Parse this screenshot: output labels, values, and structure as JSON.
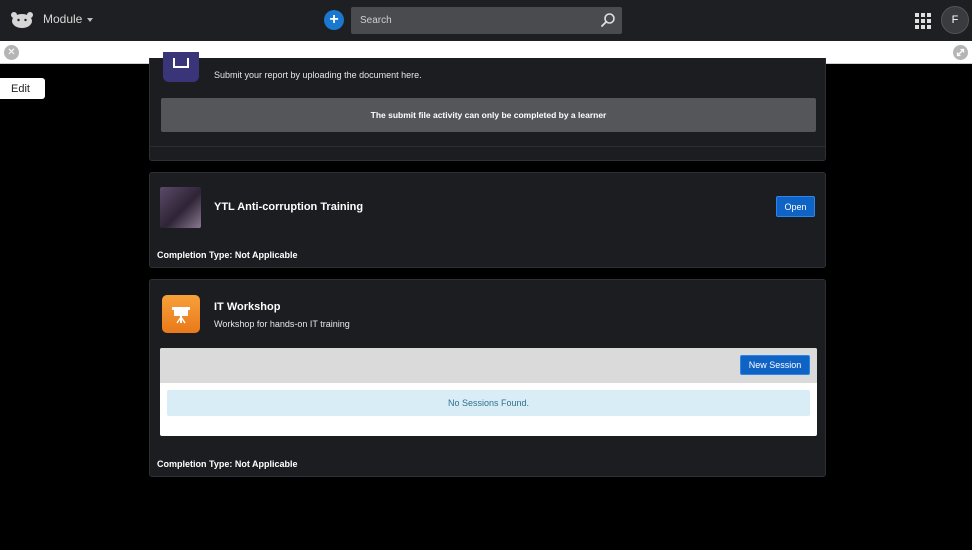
{
  "header": {
    "logo_icon": "bear-logo-icon",
    "module_label": "Module",
    "add_icon": "plus-icon",
    "search_placeholder": "Search",
    "apps_icon": "grid-apps-icon",
    "avatar_initial": "F"
  },
  "edit_bar": {
    "close_icon": "close-icon",
    "expand_icon": "expand-icon",
    "edit_label": "Edit"
  },
  "submit_activity": {
    "icon": "upload-icon",
    "description": "Submit your report by uploading the document here.",
    "notice": "The submit file activity can only be completed by a learner"
  },
  "course": {
    "title": "YTL Anti-corruption Training",
    "open_label": "Open",
    "completion": "Completion Type: Not Applicable"
  },
  "workshop": {
    "icon": "presentation-icon",
    "title": "IT Workshop",
    "description": "Workshop for hands-on IT training",
    "new_session_label": "New Session",
    "empty_message": "No Sessions Found.",
    "completion": "Completion Type: Not Applicable"
  },
  "colors": {
    "topbar": "#1e1f22",
    "card": "#1c1d21",
    "primary_button": "#0f63c4",
    "info_bg": "#d9edf7",
    "workshop_icon": "#f08a28"
  }
}
